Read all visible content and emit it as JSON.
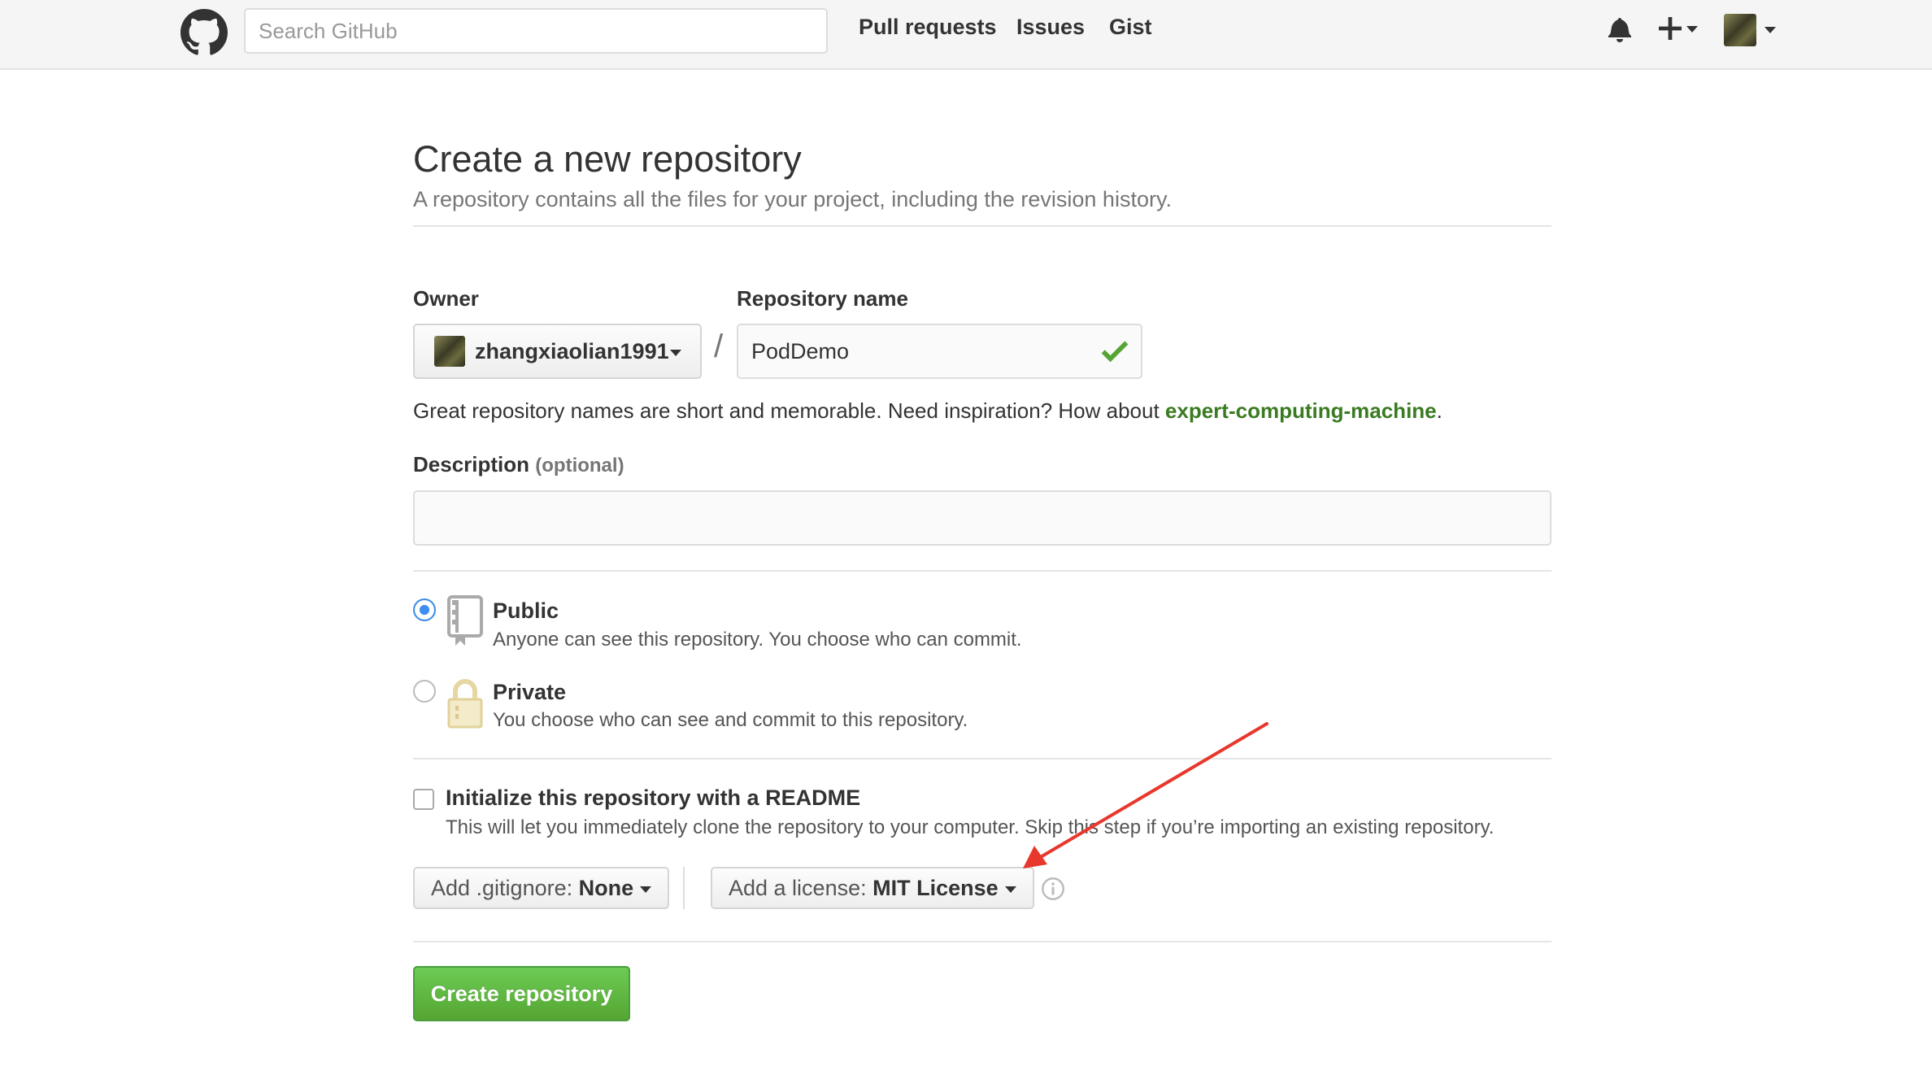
{
  "header": {
    "logo_icon": "github-octocat-icon",
    "search_placeholder": "Search GitHub",
    "nav": [
      "Pull requests",
      "Issues",
      "Gist"
    ],
    "icons": [
      "bell-icon",
      "plus-icon",
      "avatar"
    ]
  },
  "page": {
    "title": "Create a new repository",
    "subtitle": "A repository contains all the files for your project, including the revision history."
  },
  "form": {
    "owner_label": "Owner",
    "owner_value": "zhangxiaolian1991",
    "separator": "/",
    "repo_name_label": "Repository name",
    "repo_name_value": "PodDemo",
    "hint_text": "Great repository names are short and memorable. Need inspiration? How about ",
    "hint_suggestion": "expert-computing-machine",
    "hint_end": ".",
    "description_label": "Description",
    "description_optional": "(optional)",
    "description_value": "",
    "visibility": {
      "selected": "public",
      "public_title": "Public",
      "public_desc": "Anyone can see this repository. You choose who can commit.",
      "private_title": "Private",
      "private_desc": "You choose who can see and commit to this repository."
    },
    "readme_title": "Initialize this repository with a README",
    "readme_desc": "This will let you immediately clone the repository to your computer. Skip this step if you’re importing an existing repository.",
    "readme_checked": false,
    "gitignore_prefix": "Add .gitignore:",
    "gitignore_value": "None",
    "license_prefix": "Add a license:",
    "license_value": "MIT License",
    "submit_label": "Create repository"
  },
  "colors": {
    "accent_green": "#55a532",
    "link_green": "#3a7b21",
    "radio_blue": "#4a99ee",
    "annotation_red": "#e8372c"
  }
}
